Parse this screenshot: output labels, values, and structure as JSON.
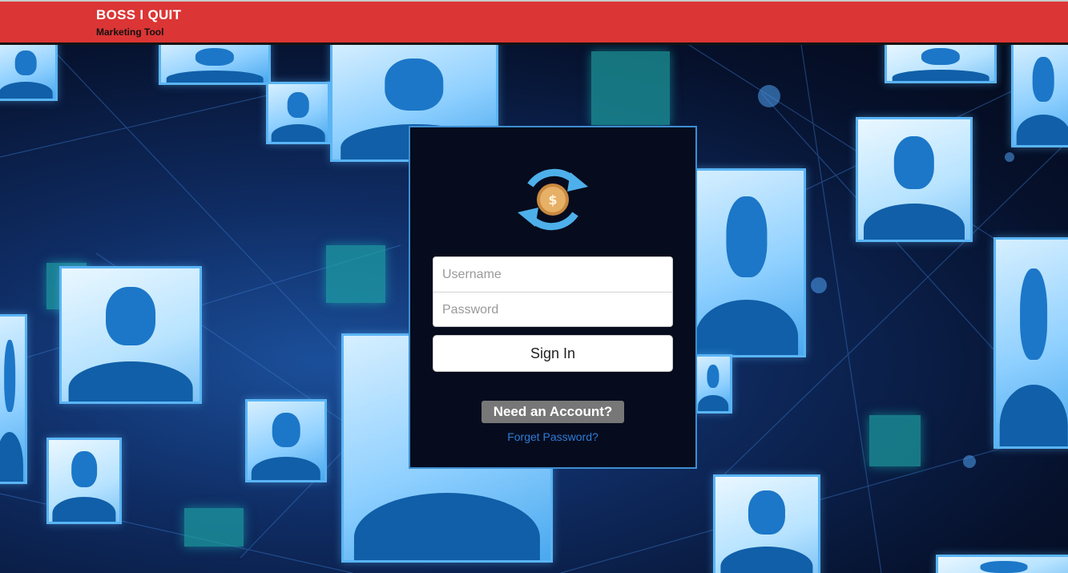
{
  "header": {
    "title": "BOSS I QUIT",
    "subtitle": "Marketing Tool"
  },
  "login": {
    "username_placeholder": "Username",
    "password_placeholder": "Password",
    "sign_in_label": "Sign In",
    "need_account_label": "Need an Account?",
    "forgot_password_label": "Forget Password?",
    "logo_icon": "refresh-coin-logo-icon"
  },
  "colors": {
    "header_bg": "#dc3535",
    "panel_bg": "#060c1e",
    "panel_border": "#3f8ed0",
    "link": "#2f7bd6",
    "need_account_bg": "#777777"
  }
}
